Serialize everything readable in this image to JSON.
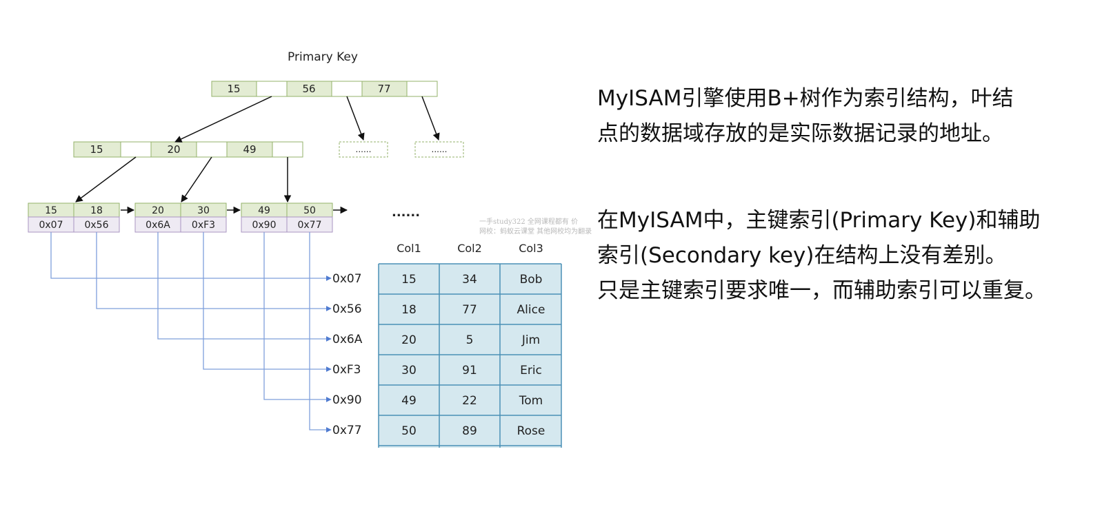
{
  "diagram": {
    "title": "Primary Key",
    "root_keys": [
      "15",
      "56",
      "77"
    ],
    "internal_keys": [
      "15",
      "20",
      "49"
    ],
    "placeholder": "......",
    "more_leaves": "......",
    "leaves": [
      {
        "keys": [
          "15",
          "18"
        ],
        "addrs": [
          "0x07",
          "0x56"
        ]
      },
      {
        "keys": [
          "20",
          "30"
        ],
        "addrs": [
          "0x6A",
          "0xF3"
        ]
      },
      {
        "keys": [
          "49",
          "50"
        ],
        "addrs": [
          "0x90",
          "0x77"
        ]
      }
    ],
    "addresses": [
      "0x07",
      "0x56",
      "0x6A",
      "0xF3",
      "0x90",
      "0x77"
    ],
    "table": {
      "columns": [
        "Col1",
        "Col2",
        "Col3"
      ],
      "rows": [
        [
          "15",
          "34",
          "Bob"
        ],
        [
          "18",
          "77",
          "Alice"
        ],
        [
          "20",
          "5",
          "Jim"
        ],
        [
          "30",
          "91",
          "Eric"
        ],
        [
          "49",
          "22",
          "Tom"
        ],
        [
          "50",
          "89",
          "Rose"
        ]
      ]
    },
    "colors": {
      "key_fill": "#e3ecd3",
      "key_border": "#93b26a",
      "addr_fill": "#eeeaf3",
      "addr_border": "#a894c2",
      "line": "#7e9fdb",
      "table_fill": "#d5e8ef",
      "table_border": "#4a8fb5"
    }
  },
  "description": {
    "para1": [
      "MyISAM引擎使用B+树作为索引结构，叶结",
      "点的数据域存放的是实际数据记录的地址。"
    ],
    "para2": [
      "在MyISAM中，主键索引(Primary Key)和辅助",
      "索引(Secondary key)在结构上没有差别。",
      "只是主键索引要求唯一，而辅助索引可以重复。"
    ]
  },
  "watermark": [
    "一手study322 全网课程都有 价",
    "网校：蚂蚁云课堂 其他网校均为翻录"
  ]
}
